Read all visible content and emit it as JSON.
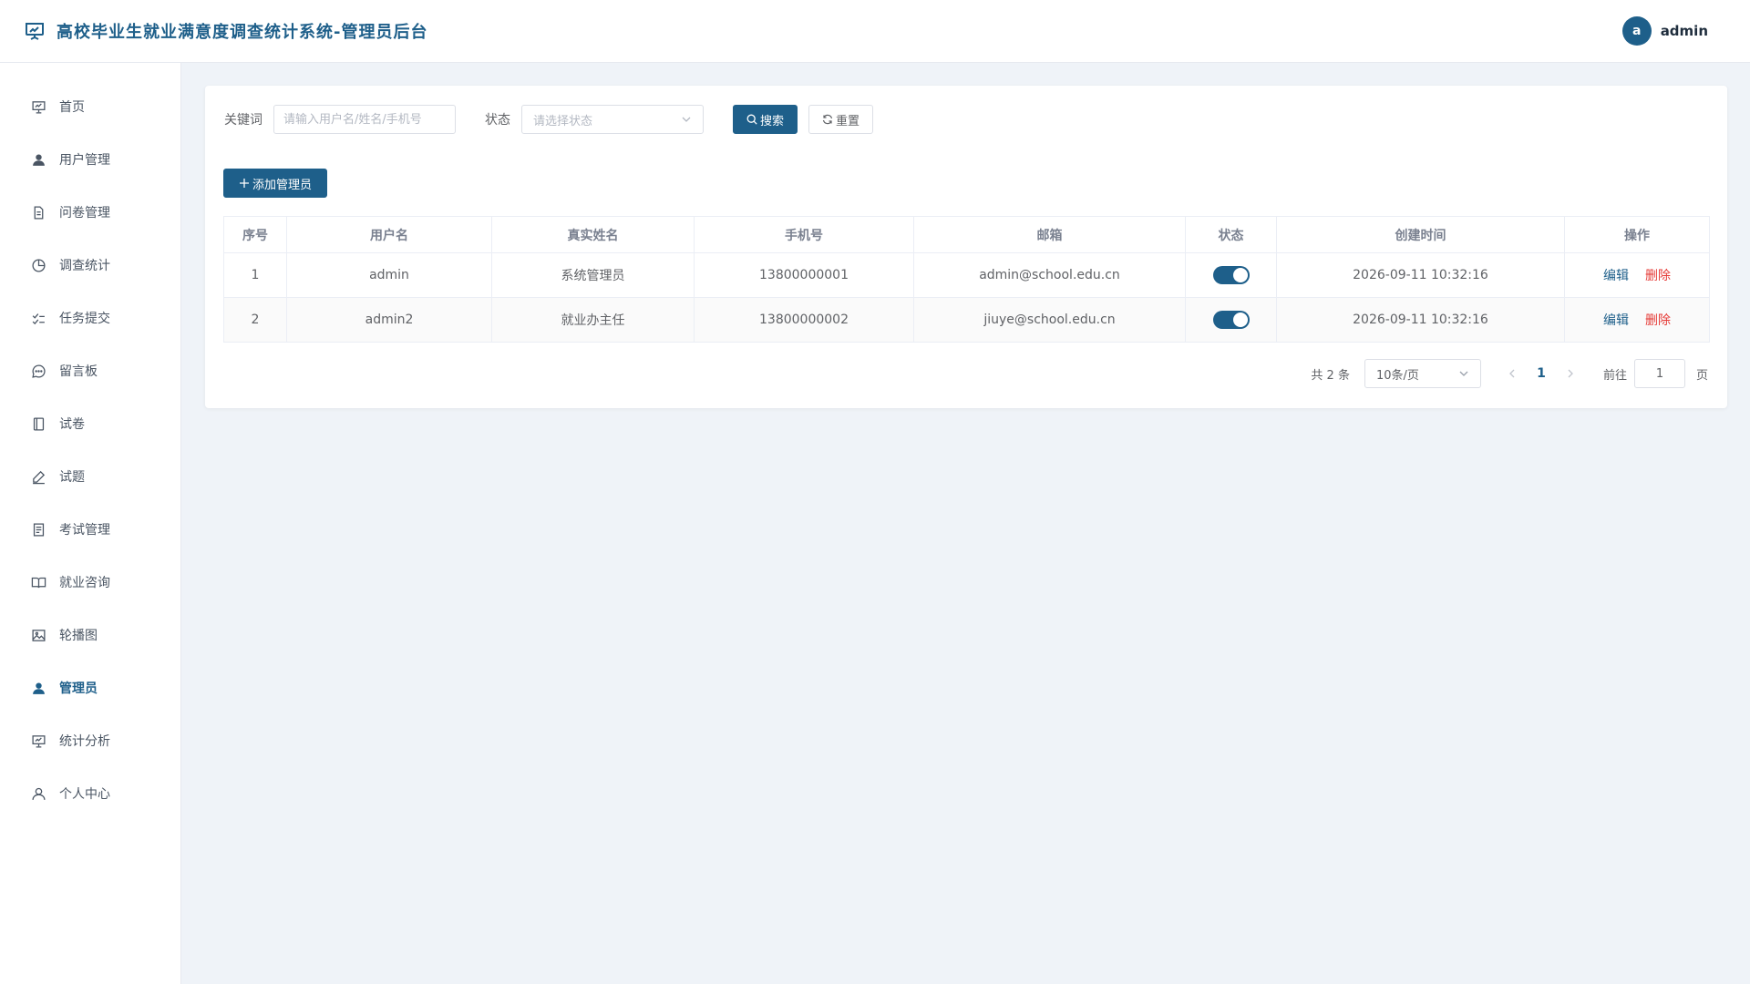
{
  "header": {
    "title": "高校毕业生就业满意度调查统计系统-管理员后台",
    "avatar_letter": "a",
    "username": "admin"
  },
  "sidebar": {
    "items": [
      {
        "label": "首页",
        "icon": "dashboard-icon"
      },
      {
        "label": "用户管理",
        "icon": "user-icon"
      },
      {
        "label": "问卷管理",
        "icon": "document-icon"
      },
      {
        "label": "调查统计",
        "icon": "pie-chart-icon"
      },
      {
        "label": "任务提交",
        "icon": "checklist-icon"
      },
      {
        "label": "留言板",
        "icon": "chat-bubble-icon"
      },
      {
        "label": "试卷",
        "icon": "notebook-icon"
      },
      {
        "label": "试题",
        "icon": "pen-icon"
      },
      {
        "label": "考试管理",
        "icon": "list-document-icon"
      },
      {
        "label": "就业咨询",
        "icon": "open-book-icon"
      },
      {
        "label": "轮播图",
        "icon": "image-icon"
      },
      {
        "label": "管理员",
        "icon": "admin-user-icon",
        "active": true
      },
      {
        "label": "统计分析",
        "icon": "presentation-icon"
      },
      {
        "label": "个人中心",
        "icon": "user-outline-icon"
      }
    ]
  },
  "filters": {
    "keyword_label": "关键词",
    "keyword_placeholder": "请输入用户名/姓名/手机号",
    "status_label": "状态",
    "status_placeholder": "请选择状态",
    "search_label": "搜索",
    "reset_label": "重置"
  },
  "actions": {
    "add_label": "添加管理员"
  },
  "table": {
    "columns": [
      "序号",
      "用户名",
      "真实姓名",
      "手机号",
      "邮箱",
      "状态",
      "创建时间",
      "操作"
    ],
    "rows": [
      {
        "index": "1",
        "username": "admin",
        "realname": "系统管理员",
        "phone": "13800000001",
        "email": "admin@school.edu.cn",
        "enabled": true,
        "created": "2026-09-11 10:32:16"
      },
      {
        "index": "2",
        "username": "admin2",
        "realname": "就业办主任",
        "phone": "13800000002",
        "email": "jiuye@school.edu.cn",
        "enabled": true,
        "created": "2026-09-11 10:32:16"
      }
    ],
    "edit_label": "编辑",
    "delete_label": "删除"
  },
  "pagination": {
    "total_text": "共 2 条",
    "page_size": "10条/页",
    "current_page": "1",
    "goto_label": "前往",
    "goto_value": "1",
    "page_suffix": "页"
  },
  "colors": {
    "primary": "#1e5f8a",
    "danger": "#e53935",
    "background": "#eff3f8"
  }
}
